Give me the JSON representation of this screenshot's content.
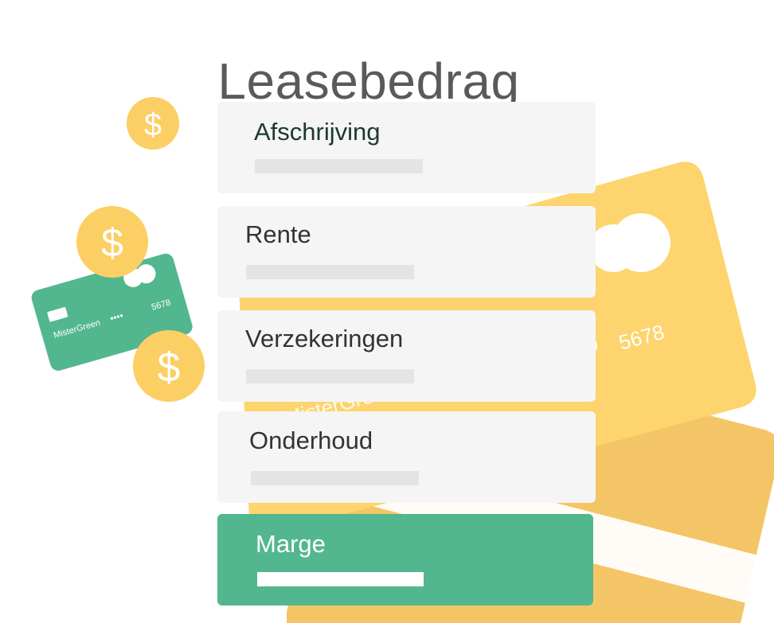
{
  "title": "Leasebedrag",
  "items": [
    {
      "label": "Afschrijving"
    },
    {
      "label": "Rente"
    },
    {
      "label": "Verzekeringen"
    },
    {
      "label": "Onderhoud"
    },
    {
      "label": "Marge"
    }
  ],
  "illustration": {
    "coin_symbol": "$",
    "small_card_brand": "MisterGreen",
    "small_card_dots": "••••",
    "small_card_number": "5678",
    "large_card_number": "5678",
    "large_card_brand": "MisterGreen"
  },
  "colors": {
    "accent_green": "#52b78f",
    "coin_yellow": "#fccf64",
    "card_yellow": "#fdd46d",
    "card_yellow_back": "#f4c566",
    "row_background": "#f5f5f5",
    "bar_placeholder": "#e4e4e4",
    "title_gray": "#5a5a5a"
  }
}
